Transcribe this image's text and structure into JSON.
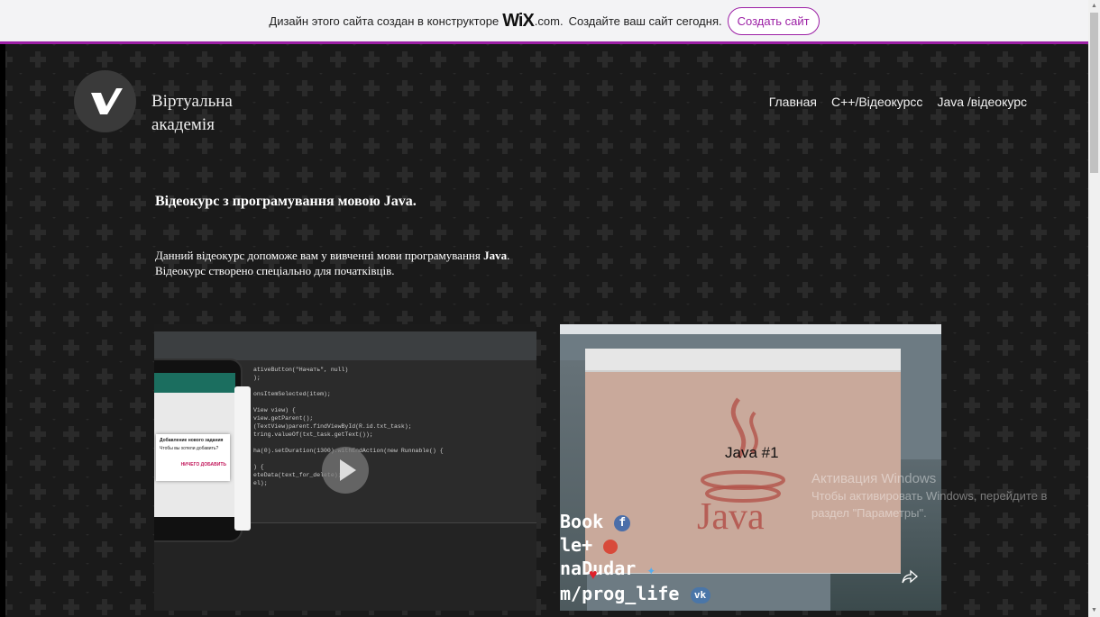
{
  "banner": {
    "text_before": "Дизайн этого сайта создан в конструкторе",
    "logo": "WiX",
    "domain": ".com.",
    "text_after": "Создайте ваш сайт сегодня.",
    "create_button": "Создать сайт",
    "accent_color": "#9c1fa5"
  },
  "site": {
    "title": "Віртуальна академія"
  },
  "nav": {
    "items": [
      "Главная",
      "C++/Відеокурсс",
      "Java /відеокурс"
    ]
  },
  "content": {
    "heading_prefix": "Відеокурс з програмування мовою",
    "heading_keyword": "Java.",
    "desc_part1": "Данний відеокурс допоможе вам у вивченні мови програмування",
    "desc_keyword": "Java",
    "desc_part2": ". Відеокурс створено спеціально для початківців."
  },
  "video1": {
    "code_lines": [
      "ativeButton(\"Начать\", null)",
      ");",
      "",
      "onsItemSelected(item);",
      "",
      "View view) {",
      "view.getParent();",
      "(TextView)parent.findViewById(R.id.txt_task);",
      "tring.valueOf(txt_task.getText());",
      "",
      "ha(0).setDuration(1300).withEndAction(new Runnable() {",
      "",
      ") {",
      "eteData(text_for_delete);",
      "el);"
    ],
    "dialog_title": "Добавление нового задания",
    "dialog_text": "Чтобы вы хотели добавить?",
    "dialog_cancel": "НИЧЕГО",
    "dialog_add": "ДОБАВИТЬ"
  },
  "video2": {
    "title": "Java #1",
    "logo_text": "Java",
    "social_lines": [
      "Book",
      "le+",
      "naDudar",
      "m/prog_life"
    ]
  },
  "watermark": {
    "line1": "Активация Windows",
    "line2": "Чтобы активировать Windows, перейдите в",
    "line3": "раздел \"Параметры\"."
  }
}
